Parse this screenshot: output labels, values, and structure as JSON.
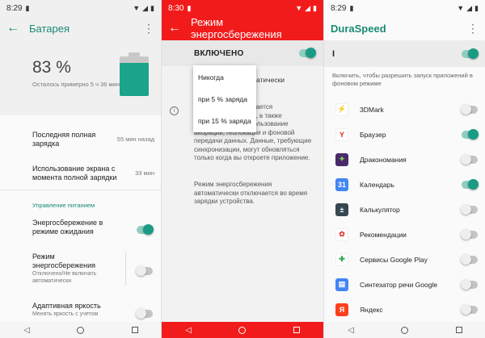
{
  "panel1": {
    "status_time": "8:29",
    "title": "Батарея",
    "battery_percent": "83 %",
    "battery_level": 0.83,
    "battery_remaining": "Осталось примерно 5 ч 36 мин",
    "last_charge_label": "Последняя полная зарядка",
    "last_charge_value": "55 мин назад",
    "screen_usage_label": "Использование экрана с момента полной зарядки",
    "screen_usage_value": "33 мин",
    "section_title": "Управление питанием",
    "standby_label": "Энергосбережение в режиме ожидания",
    "standby_on": true,
    "saver_label": "Режим энергосбережения",
    "saver_sub": "Отключено/Не включать автоматически",
    "saver_on": false,
    "adaptive_label": "Адаптивная яркость",
    "adaptive_sub": "Менять яркость с учетом"
  },
  "panel2": {
    "status_time": "8:30",
    "title": "Режим энергосбережения",
    "on_label": "ВКЛЮЧЕНО",
    "on_toggle": true,
    "behind_auto": "атически",
    "behind_text": "работы в режиме ижается производительность, а также ограничивается использование вибрации, геолокации и фоновой передачи данных. Данные, требующие синхронизации, могут обновляться только когда вы откроете приложение.",
    "behind_text2": "Режим энергосбережения автоматически отключается во время зарядки устройства.",
    "popup_options": [
      "Никогда",
      "при 5 % заряда",
      "при 15 % заряда"
    ]
  },
  "panel3": {
    "status_time": "8:29",
    "title": "DuraSpeed",
    "master_label": "I",
    "master_on": true,
    "description": "Включить, чтобы разрешить запуск приложений в фоновом режиме",
    "apps": [
      {
        "name": "3DMark",
        "on": false,
        "icon": "3dmark-icon",
        "color": "#ffffff",
        "glyph": "⚡",
        "fg": "#f39c12"
      },
      {
        "name": "Браузер",
        "on": true,
        "icon": "yandex-browser-icon",
        "color": "#ffffff",
        "glyph": "Y",
        "fg": "#e52620"
      },
      {
        "name": "Дракономания",
        "on": false,
        "icon": "dragon-icon",
        "color": "#4a2a6a",
        "glyph": "✦",
        "fg": "#7fd34a"
      },
      {
        "name": "Календарь",
        "on": true,
        "icon": "calendar-icon",
        "color": "#4285f4",
        "glyph": "31",
        "fg": "#ffffff"
      },
      {
        "name": "Калькулятор",
        "on": false,
        "icon": "calculator-icon",
        "color": "#37474f",
        "glyph": "±",
        "fg": "#ffffff"
      },
      {
        "name": "Рекомендации",
        "on": false,
        "icon": "recommendations-icon",
        "color": "#ffffff",
        "glyph": "✿",
        "fg": "#e53935"
      },
      {
        "name": "Сервисы Google Play",
        "on": false,
        "icon": "google-play-services-icon",
        "color": "#ffffff",
        "glyph": "✚",
        "fg": "#34a853"
      },
      {
        "name": "Синтезатор речи Google",
        "on": false,
        "icon": "tts-icon",
        "color": "#4285f4",
        "glyph": "▤",
        "fg": "#ffffff"
      },
      {
        "name": "Яндекс",
        "on": false,
        "icon": "yandex-icon",
        "color": "#fc3f1d",
        "glyph": "Я",
        "fg": "#ffffff"
      }
    ]
  }
}
